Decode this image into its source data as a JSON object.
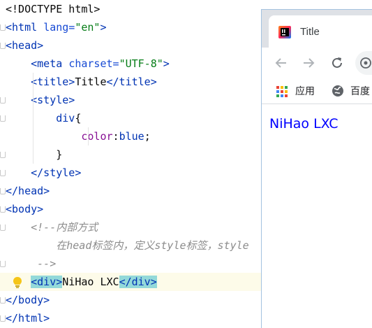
{
  "editor": {
    "lines": [
      {
        "tokens": [
          {
            "t": "<!DOCTYPE html>",
            "c": "plain"
          }
        ]
      },
      {
        "tokens": [
          {
            "t": "<html ",
            "c": "tag"
          },
          {
            "t": "lang=",
            "c": "attr"
          },
          {
            "t": "\"en\"",
            "c": "str"
          },
          {
            "t": ">",
            "c": "tag"
          }
        ]
      },
      {
        "tokens": [
          {
            "t": "<head>",
            "c": "tag"
          }
        ]
      },
      {
        "tokens": [
          {
            "t": "    "
          },
          {
            "t": "<meta ",
            "c": "tag"
          },
          {
            "t": "charset=",
            "c": "attr"
          },
          {
            "t": "\"UTF-8\"",
            "c": "str"
          },
          {
            "t": ">",
            "c": "tag"
          }
        ]
      },
      {
        "tokens": [
          {
            "t": "    "
          },
          {
            "t": "<title>",
            "c": "tag"
          },
          {
            "t": "Title",
            "c": "plain"
          },
          {
            "t": "</title>",
            "c": "tag"
          }
        ]
      },
      {
        "tokens": [
          {
            "t": "    "
          },
          {
            "t": "<style>",
            "c": "tag"
          }
        ]
      },
      {
        "tokens": [
          {
            "t": "        "
          },
          {
            "t": "div",
            "c": "tag"
          },
          {
            "t": "{",
            "c": "plain"
          }
        ]
      },
      {
        "tokens": [
          {
            "t": "            "
          },
          {
            "t": "color",
            "c": "prop"
          },
          {
            "t": ":",
            "c": "plain"
          },
          {
            "t": "blue",
            "c": "val"
          },
          {
            "t": ";",
            "c": "plain"
          }
        ]
      },
      {
        "tokens": [
          {
            "t": "        "
          },
          {
            "t": "}",
            "c": "plain"
          }
        ]
      },
      {
        "tokens": [
          {
            "t": "    "
          },
          {
            "t": "</style>",
            "c": "tag"
          }
        ]
      },
      {
        "tokens": [
          {
            "t": "</head>",
            "c": "tag"
          }
        ]
      },
      {
        "tokens": [
          {
            "t": "<body>",
            "c": "tag"
          }
        ]
      },
      {
        "tokens": [
          {
            "t": "    "
          },
          {
            "t": "<!--内部方式",
            "c": "cmt"
          }
        ]
      },
      {
        "tokens": [
          {
            "t": "        "
          },
          {
            "t": "在head标签内，定义style标签，style",
            "c": "cmt"
          }
        ]
      },
      {
        "tokens": [
          {
            "t": "     "
          },
          {
            "t": "-->",
            "c": "cmt"
          }
        ]
      },
      {
        "tokens": [
          {
            "t": "    "
          },
          {
            "t": "<div>",
            "c": "tag",
            "hl": true
          },
          {
            "t": "NiHao LXC",
            "c": "plain"
          },
          {
            "t": "</div>",
            "c": "tag",
            "hl": true
          }
        ],
        "current": true
      },
      {
        "tokens": [
          {
            "t": "</body>",
            "c": "tag"
          }
        ]
      },
      {
        "tokens": [
          {
            "t": "</html>",
            "c": "tag"
          }
        ]
      }
    ]
  },
  "browser": {
    "tab_title": "Title",
    "bookmarks": [
      {
        "icon": "apps-grid-icon",
        "label": "应用"
      },
      {
        "icon": "globe-icon",
        "label": "百度"
      }
    ],
    "page_text": "NiHao LXC",
    "page_text_color": "#0000ff"
  },
  "colors": {
    "tag": "#0033b3",
    "string": "#067d17",
    "property": "#871094",
    "comment": "#8c8c8c",
    "current_line": "#fdfbe9",
    "tag_match_highlight": "#93d9d9"
  }
}
